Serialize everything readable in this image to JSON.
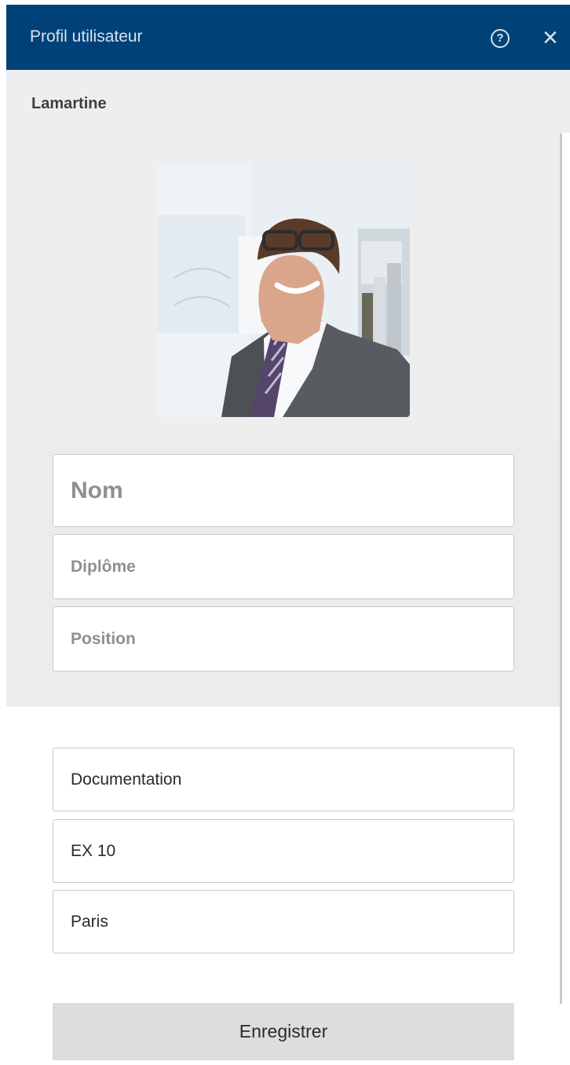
{
  "window": {
    "title": "Profil utilisateur",
    "help_icon": "help-circle-icon",
    "close_icon": "close-icon"
  },
  "profile": {
    "name": "Lamartine",
    "photo_alt": "Photo de profil"
  },
  "identity_fields": [
    {
      "placeholder": "Nom",
      "value": ""
    },
    {
      "placeholder": "Diplôme",
      "value": ""
    },
    {
      "placeholder": "Position",
      "value": ""
    }
  ],
  "detail_fields": [
    {
      "value": "Documentation"
    },
    {
      "value": "EX 10"
    },
    {
      "value": "Paris"
    }
  ],
  "actions": {
    "save_label": "Enregistrer"
  },
  "colors": {
    "titlebar": "#004278",
    "subheader": "#eceef0",
    "field_border": "#c9c9c9",
    "button": "#dddddd"
  }
}
